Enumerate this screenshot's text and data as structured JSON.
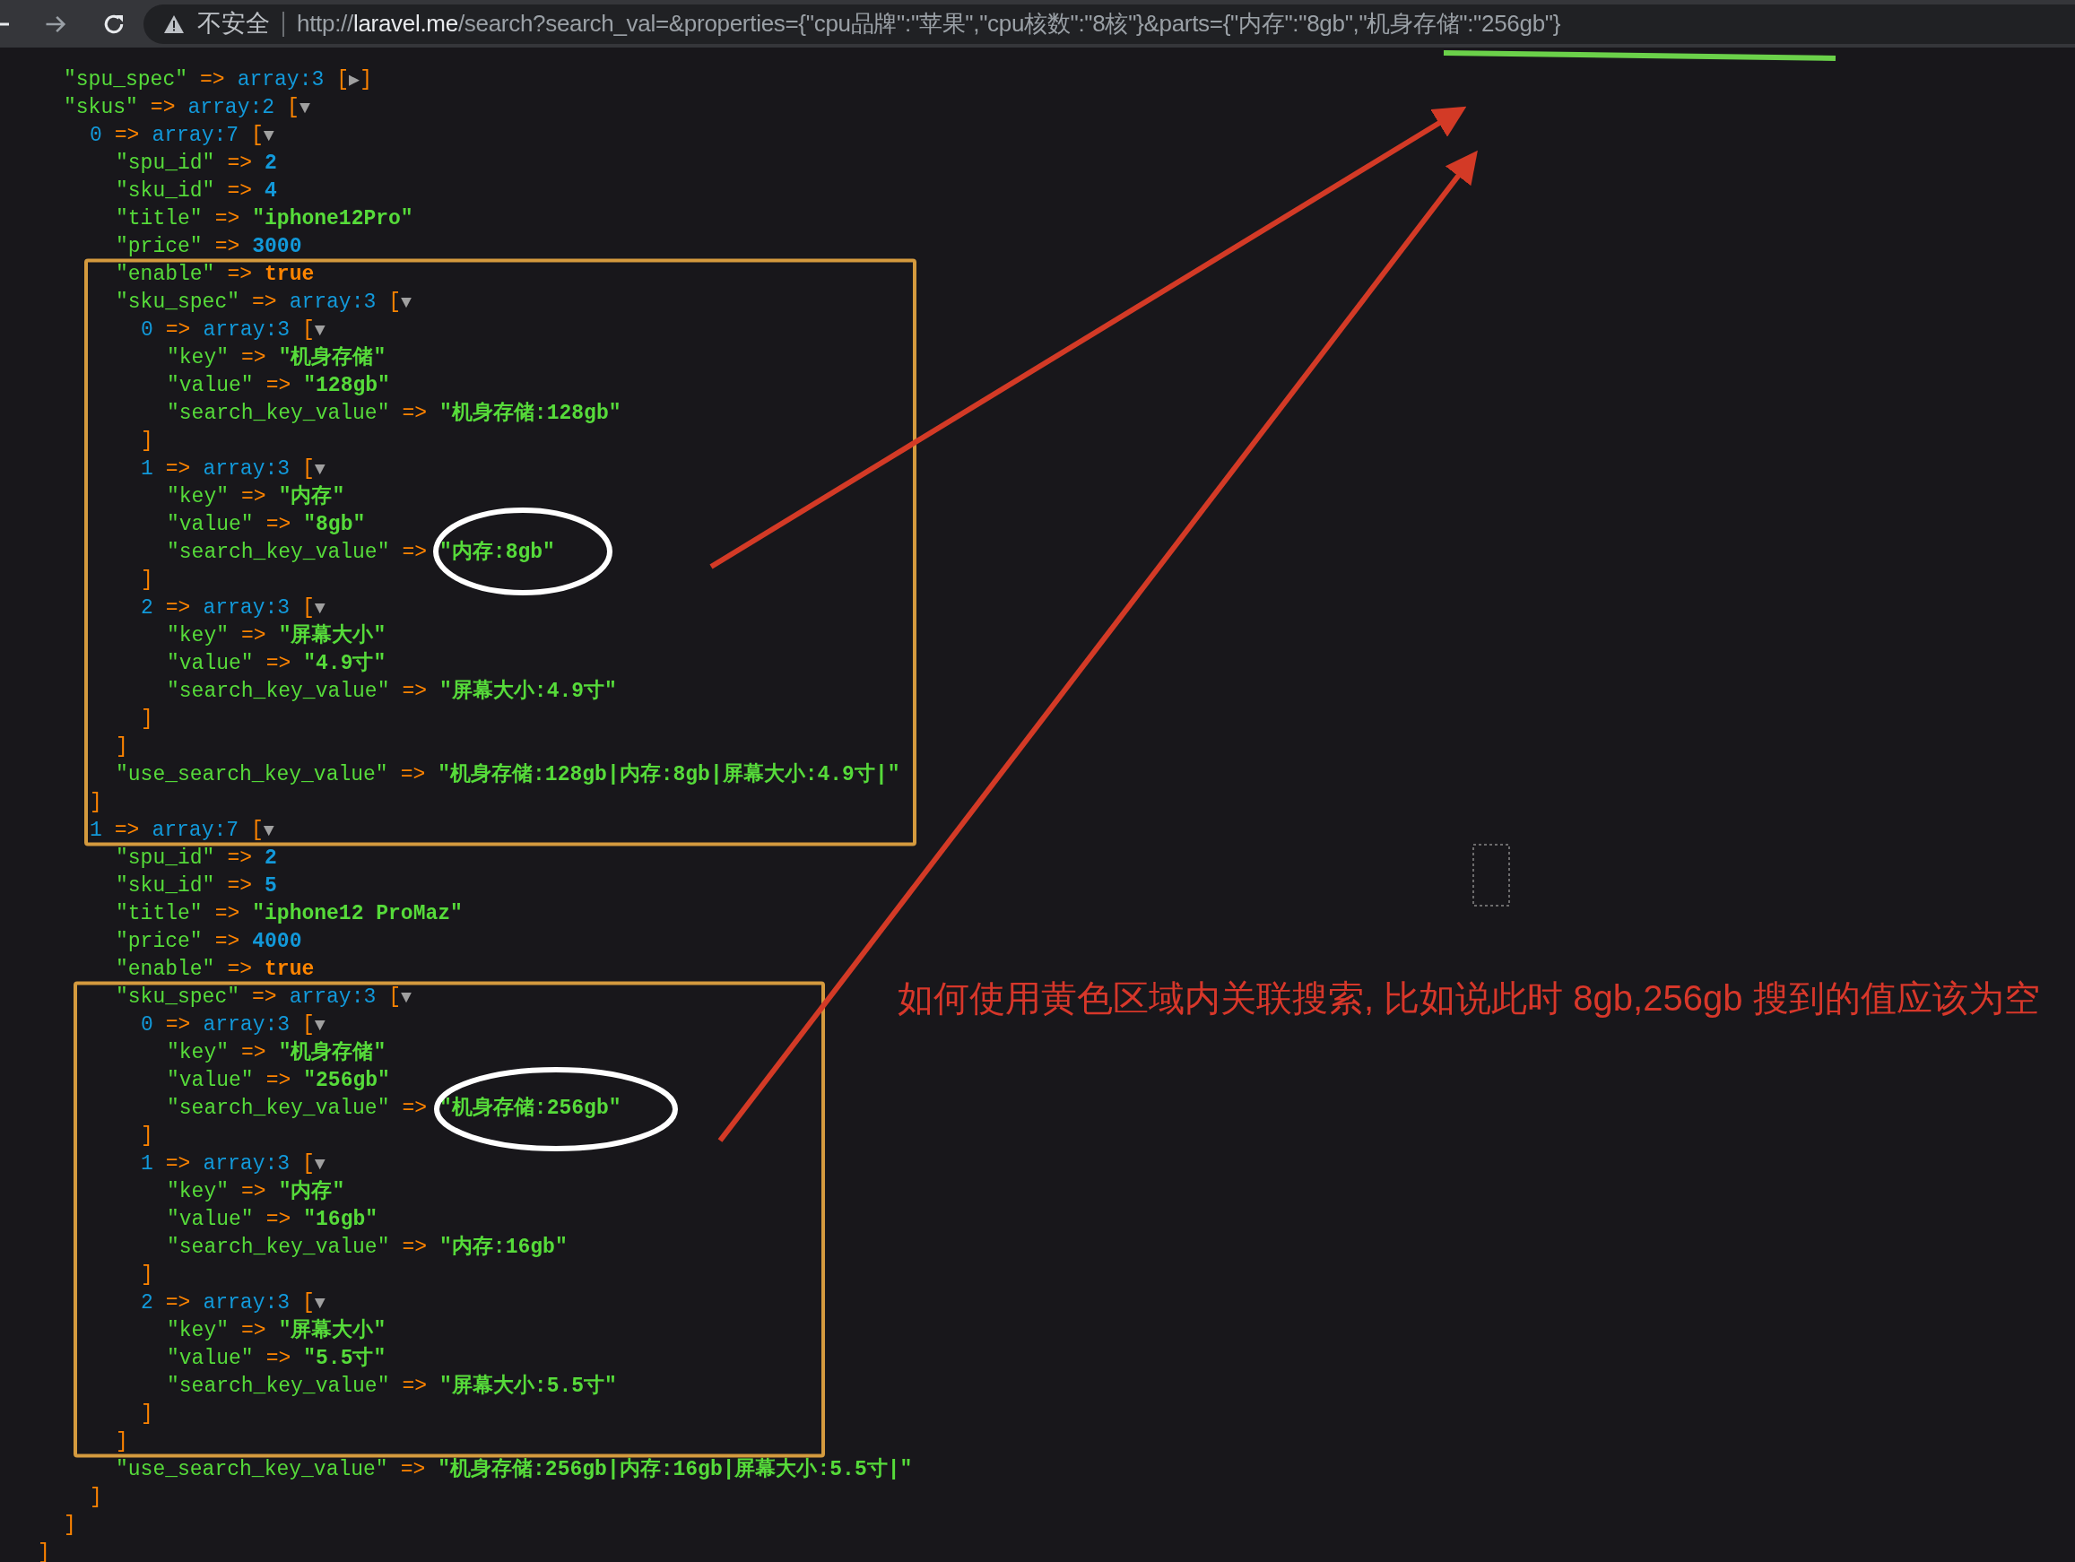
{
  "browser": {
    "security_label": "不安全",
    "url_scheme": "http://",
    "url_host": "laravel.me",
    "url_rest": "/search?search_val=&properties={\"cpu品牌\":\"苹果\",\"cpu核数\":\"8核\"}&parts={\"内存\":\"8gb\",\"机身存储\":\"256gb\"}"
  },
  "dump": {
    "root": {
      "close": [
        {
          "kind": "bracket",
          "text": "]"
        }
      ],
      "children": [
        {
          "parts": [
            {
              "kind": "key",
              "text": "\"spu_spec\""
            },
            {
              "kind": "arrow",
              "text": "=>"
            },
            {
              "kind": "type",
              "text": "array:3"
            },
            {
              "kind": "bracket",
              "text": "["
            },
            {
              "kind": "toggle",
              "text": "▶"
            },
            {
              "kind": "bracket",
              "text": "]"
            }
          ]
        },
        {
          "parts": [
            {
              "kind": "key",
              "text": "\"skus\""
            },
            {
              "kind": "arrow",
              "text": "=>"
            },
            {
              "kind": "type",
              "text": "array:2"
            },
            {
              "kind": "bracket",
              "text": "["
            },
            {
              "kind": "toggle",
              "text": "▼"
            }
          ],
          "close": [
            {
              "kind": "bracket",
              "text": "]"
            }
          ],
          "children": [
            {
              "parts": [
                {
                  "kind": "index",
                  "text": "0"
                },
                {
                  "kind": "arrow",
                  "text": "=>"
                },
                {
                  "kind": "type",
                  "text": "array:7"
                },
                {
                  "kind": "bracket",
                  "text": "["
                },
                {
                  "kind": "toggle",
                  "text": "▼"
                }
              ],
              "close": [
                {
                  "kind": "bracket",
                  "text": "]"
                }
              ],
              "children": [
                {
                  "parts": [
                    {
                      "kind": "key",
                      "text": "\"spu_id\""
                    },
                    {
                      "kind": "arrow",
                      "text": "=>"
                    },
                    {
                      "kind": "num",
                      "text": "2"
                    }
                  ]
                },
                {
                  "parts": [
                    {
                      "kind": "key",
                      "text": "\"sku_id\""
                    },
                    {
                      "kind": "arrow",
                      "text": "=>"
                    },
                    {
                      "kind": "num",
                      "text": "4"
                    }
                  ]
                },
                {
                  "parts": [
                    {
                      "kind": "key",
                      "text": "\"title\""
                    },
                    {
                      "kind": "arrow",
                      "text": "=>"
                    },
                    {
                      "kind": "str",
                      "text": "\"iphone12Pro\""
                    }
                  ]
                },
                {
                  "parts": [
                    {
                      "kind": "key",
                      "text": "\"price\""
                    },
                    {
                      "kind": "arrow",
                      "text": "=>"
                    },
                    {
                      "kind": "num",
                      "text": "3000"
                    }
                  ]
                },
                {
                  "parts": [
                    {
                      "kind": "key",
                      "text": "\"enable\""
                    },
                    {
                      "kind": "arrow",
                      "text": "=>"
                    },
                    {
                      "kind": "bool",
                      "text": "true"
                    }
                  ]
                },
                {
                  "parts": [
                    {
                      "kind": "key",
                      "text": "\"sku_spec\""
                    },
                    {
                      "kind": "arrow",
                      "text": "=>"
                    },
                    {
                      "kind": "type",
                      "text": "array:3"
                    },
                    {
                      "kind": "bracket",
                      "text": "["
                    },
                    {
                      "kind": "toggle",
                      "text": "▼"
                    }
                  ],
                  "close": [
                    {
                      "kind": "bracket",
                      "text": "]"
                    }
                  ],
                  "children": [
                    {
                      "parts": [
                        {
                          "kind": "index",
                          "text": "0"
                        },
                        {
                          "kind": "arrow",
                          "text": "=>"
                        },
                        {
                          "kind": "type",
                          "text": "array:3"
                        },
                        {
                          "kind": "bracket",
                          "text": "["
                        },
                        {
                          "kind": "toggle",
                          "text": "▼"
                        }
                      ],
                      "close": [
                        {
                          "kind": "bracket",
                          "text": "]"
                        }
                      ],
                      "children": [
                        {
                          "parts": [
                            {
                              "kind": "key",
                              "text": "\"key\""
                            },
                            {
                              "kind": "arrow",
                              "text": "=>"
                            },
                            {
                              "kind": "str",
                              "text": "\"机身存储\""
                            }
                          ]
                        },
                        {
                          "parts": [
                            {
                              "kind": "key",
                              "text": "\"value\""
                            },
                            {
                              "kind": "arrow",
                              "text": "=>"
                            },
                            {
                              "kind": "str",
                              "text": "\"128gb\""
                            }
                          ]
                        },
                        {
                          "parts": [
                            {
                              "kind": "key",
                              "text": "\"search_key_value\""
                            },
                            {
                              "kind": "arrow",
                              "text": "=>"
                            },
                            {
                              "kind": "str",
                              "text": "\"机身存储:128gb\""
                            }
                          ]
                        }
                      ]
                    },
                    {
                      "parts": [
                        {
                          "kind": "index",
                          "text": "1"
                        },
                        {
                          "kind": "arrow",
                          "text": "=>"
                        },
                        {
                          "kind": "type",
                          "text": "array:3"
                        },
                        {
                          "kind": "bracket",
                          "text": "["
                        },
                        {
                          "kind": "toggle",
                          "text": "▼"
                        }
                      ],
                      "close": [
                        {
                          "kind": "bracket",
                          "text": "]"
                        }
                      ],
                      "children": [
                        {
                          "parts": [
                            {
                              "kind": "key",
                              "text": "\"key\""
                            },
                            {
                              "kind": "arrow",
                              "text": "=>"
                            },
                            {
                              "kind": "str",
                              "text": "\"内存\""
                            }
                          ]
                        },
                        {
                          "parts": [
                            {
                              "kind": "key",
                              "text": "\"value\""
                            },
                            {
                              "kind": "arrow",
                              "text": "=>"
                            },
                            {
                              "kind": "str",
                              "text": "\"8gb\""
                            }
                          ]
                        },
                        {
                          "parts": [
                            {
                              "kind": "key",
                              "text": "\"search_key_value\""
                            },
                            {
                              "kind": "arrow",
                              "text": "=>"
                            },
                            {
                              "kind": "str",
                              "text": "\"内存:8gb\""
                            }
                          ]
                        }
                      ]
                    },
                    {
                      "parts": [
                        {
                          "kind": "index",
                          "text": "2"
                        },
                        {
                          "kind": "arrow",
                          "text": "=>"
                        },
                        {
                          "kind": "type",
                          "text": "array:3"
                        },
                        {
                          "kind": "bracket",
                          "text": "["
                        },
                        {
                          "kind": "toggle",
                          "text": "▼"
                        }
                      ],
                      "close": [
                        {
                          "kind": "bracket",
                          "text": "]"
                        }
                      ],
                      "children": [
                        {
                          "parts": [
                            {
                              "kind": "key",
                              "text": "\"key\""
                            },
                            {
                              "kind": "arrow",
                              "text": "=>"
                            },
                            {
                              "kind": "str",
                              "text": "\"屏幕大小\""
                            }
                          ]
                        },
                        {
                          "parts": [
                            {
                              "kind": "key",
                              "text": "\"value\""
                            },
                            {
                              "kind": "arrow",
                              "text": "=>"
                            },
                            {
                              "kind": "str",
                              "text": "\"4.9寸\""
                            }
                          ]
                        },
                        {
                          "parts": [
                            {
                              "kind": "key",
                              "text": "\"search_key_value\""
                            },
                            {
                              "kind": "arrow",
                              "text": "=>"
                            },
                            {
                              "kind": "str",
                              "text": "\"屏幕大小:4.9寸\""
                            }
                          ]
                        }
                      ]
                    }
                  ]
                },
                {
                  "parts": [
                    {
                      "kind": "key",
                      "text": "\"use_search_key_value\""
                    },
                    {
                      "kind": "arrow",
                      "text": "=>"
                    },
                    {
                      "kind": "str",
                      "text": "\"机身存储:128gb|内存:8gb|屏幕大小:4.9寸|\""
                    }
                  ]
                }
              ]
            },
            {
              "parts": [
                {
                  "kind": "index",
                  "text": "1"
                },
                {
                  "kind": "arrow",
                  "text": "=>"
                },
                {
                  "kind": "type",
                  "text": "array:7"
                },
                {
                  "kind": "bracket",
                  "text": "["
                },
                {
                  "kind": "toggle",
                  "text": "▼"
                }
              ],
              "close": [
                {
                  "kind": "bracket",
                  "text": "]"
                }
              ],
              "children": [
                {
                  "parts": [
                    {
                      "kind": "key",
                      "text": "\"spu_id\""
                    },
                    {
                      "kind": "arrow",
                      "text": "=>"
                    },
                    {
                      "kind": "num",
                      "text": "2"
                    }
                  ]
                },
                {
                  "parts": [
                    {
                      "kind": "key",
                      "text": "\"sku_id\""
                    },
                    {
                      "kind": "arrow",
                      "text": "=>"
                    },
                    {
                      "kind": "num",
                      "text": "5"
                    }
                  ]
                },
                {
                  "parts": [
                    {
                      "kind": "key",
                      "text": "\"title\""
                    },
                    {
                      "kind": "arrow",
                      "text": "=>"
                    },
                    {
                      "kind": "str",
                      "text": "\"iphone12 ProMaz\""
                    }
                  ]
                },
                {
                  "parts": [
                    {
                      "kind": "key",
                      "text": "\"price\""
                    },
                    {
                      "kind": "arrow",
                      "text": "=>"
                    },
                    {
                      "kind": "num",
                      "text": "4000"
                    }
                  ]
                },
                {
                  "parts": [
                    {
                      "kind": "key",
                      "text": "\"enable\""
                    },
                    {
                      "kind": "arrow",
                      "text": "=>"
                    },
                    {
                      "kind": "bool",
                      "text": "true"
                    }
                  ]
                },
                {
                  "parts": [
                    {
                      "kind": "key",
                      "text": "\"sku_spec\""
                    },
                    {
                      "kind": "arrow",
                      "text": "=>"
                    },
                    {
                      "kind": "type",
                      "text": "array:3"
                    },
                    {
                      "kind": "bracket",
                      "text": "["
                    },
                    {
                      "kind": "toggle",
                      "text": "▼"
                    }
                  ],
                  "close": [
                    {
                      "kind": "bracket",
                      "text": "]"
                    }
                  ],
                  "children": [
                    {
                      "parts": [
                        {
                          "kind": "index",
                          "text": "0"
                        },
                        {
                          "kind": "arrow",
                          "text": "=>"
                        },
                        {
                          "kind": "type",
                          "text": "array:3"
                        },
                        {
                          "kind": "bracket",
                          "text": "["
                        },
                        {
                          "kind": "toggle",
                          "text": "▼"
                        }
                      ],
                      "close": [
                        {
                          "kind": "bracket",
                          "text": "]"
                        }
                      ],
                      "children": [
                        {
                          "parts": [
                            {
                              "kind": "key",
                              "text": "\"key\""
                            },
                            {
                              "kind": "arrow",
                              "text": "=>"
                            },
                            {
                              "kind": "str",
                              "text": "\"机身存储\""
                            }
                          ]
                        },
                        {
                          "parts": [
                            {
                              "kind": "key",
                              "text": "\"value\""
                            },
                            {
                              "kind": "arrow",
                              "text": "=>"
                            },
                            {
                              "kind": "str",
                              "text": "\"256gb\""
                            }
                          ]
                        },
                        {
                          "parts": [
                            {
                              "kind": "key",
                              "text": "\"search_key_value\""
                            },
                            {
                              "kind": "arrow",
                              "text": "=>"
                            },
                            {
                              "kind": "str",
                              "text": "\"机身存储:256gb\""
                            }
                          ]
                        }
                      ]
                    },
                    {
                      "parts": [
                        {
                          "kind": "index",
                          "text": "1"
                        },
                        {
                          "kind": "arrow",
                          "text": "=>"
                        },
                        {
                          "kind": "type",
                          "text": "array:3"
                        },
                        {
                          "kind": "bracket",
                          "text": "["
                        },
                        {
                          "kind": "toggle",
                          "text": "▼"
                        }
                      ],
                      "close": [
                        {
                          "kind": "bracket",
                          "text": "]"
                        }
                      ],
                      "children": [
                        {
                          "parts": [
                            {
                              "kind": "key",
                              "text": "\"key\""
                            },
                            {
                              "kind": "arrow",
                              "text": "=>"
                            },
                            {
                              "kind": "str",
                              "text": "\"内存\""
                            }
                          ]
                        },
                        {
                          "parts": [
                            {
                              "kind": "key",
                              "text": "\"value\""
                            },
                            {
                              "kind": "arrow",
                              "text": "=>"
                            },
                            {
                              "kind": "str",
                              "text": "\"16gb\""
                            }
                          ]
                        },
                        {
                          "parts": [
                            {
                              "kind": "key",
                              "text": "\"search_key_value\""
                            },
                            {
                              "kind": "arrow",
                              "text": "=>"
                            },
                            {
                              "kind": "str",
                              "text": "\"内存:16gb\""
                            }
                          ]
                        }
                      ]
                    },
                    {
                      "parts": [
                        {
                          "kind": "index",
                          "text": "2"
                        },
                        {
                          "kind": "arrow",
                          "text": "=>"
                        },
                        {
                          "kind": "type",
                          "text": "array:3"
                        },
                        {
                          "kind": "bracket",
                          "text": "["
                        },
                        {
                          "kind": "toggle",
                          "text": "▼"
                        }
                      ],
                      "close": [
                        {
                          "kind": "bracket",
                          "text": "]"
                        }
                      ],
                      "children": [
                        {
                          "parts": [
                            {
                              "kind": "key",
                              "text": "\"key\""
                            },
                            {
                              "kind": "arrow",
                              "text": "=>"
                            },
                            {
                              "kind": "str",
                              "text": "\"屏幕大小\""
                            }
                          ]
                        },
                        {
                          "parts": [
                            {
                              "kind": "key",
                              "text": "\"value\""
                            },
                            {
                              "kind": "arrow",
                              "text": "=>"
                            },
                            {
                              "kind": "str",
                              "text": "\"5.5寸\""
                            }
                          ]
                        },
                        {
                          "parts": [
                            {
                              "kind": "key",
                              "text": "\"search_key_value\""
                            },
                            {
                              "kind": "arrow",
                              "text": "=>"
                            },
                            {
                              "kind": "str",
                              "text": "\"屏幕大小:5.5寸\""
                            }
                          ]
                        }
                      ]
                    }
                  ]
                },
                {
                  "parts": [
                    {
                      "kind": "key",
                      "text": "\"use_search_key_value\""
                    },
                    {
                      "kind": "arrow",
                      "text": "=>"
                    },
                    {
                      "kind": "str",
                      "text": "\"机身存储:256gb|内存:16gb|屏幕大小:5.5寸|\""
                    }
                  ]
                }
              ]
            }
          ]
        }
      ]
    }
  },
  "annotation": {
    "note": "如何使用黄色区域内关联搜索, 比如说此时 8gb,256gb 搜到的值应该为空"
  }
}
